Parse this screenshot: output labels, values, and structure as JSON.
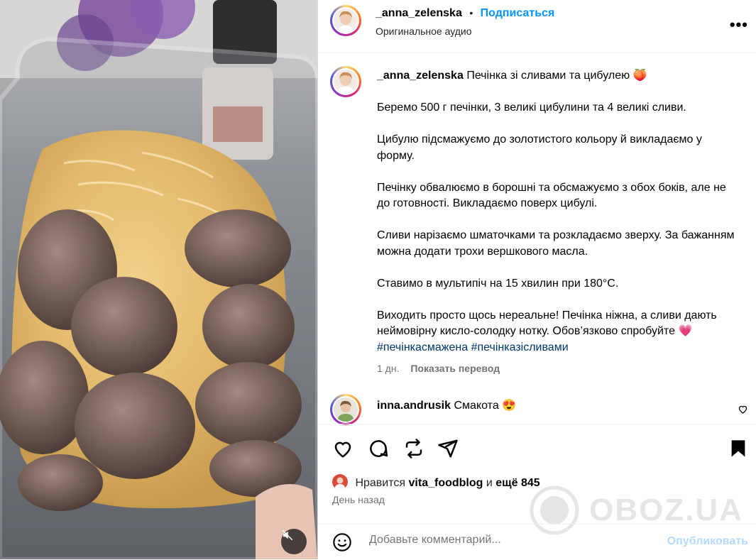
{
  "post": {
    "author": "_anna_zelenska",
    "separator": "•",
    "follow_label": "Подписаться",
    "audio": "Оригинальное аудио",
    "more_label": "•••"
  },
  "caption": {
    "username": "_anna_zelenska",
    "title": "Печінка зі сливами та цибулею",
    "title_emoji": "🍑",
    "paragraphs": [
      "Беремо 500 г печінки, 3 великі цибулини та 4 великі сливи.",
      "Цибулю підсмажуємо до золотистого кольору й викладаємо у форму.",
      "Печінку обвалюємо в борошні та обсмажуємо з обох боків, але не до готовності. Викладаємо поверх цибулі.",
      "Сливи нарізаємо шматочками та розкладаємо зверху. За бажанням можна додати трохи вершкового масла.",
      "Ставимо в мультипіч на 15 хвилин при 180°C."
    ],
    "last_paragraph": "Виходить просто щось нереальне! Печінка ніжна, а сливи дають неймовірну кисло-солодку нотку. Обов’язково спробуйте",
    "last_emoji": "💗",
    "hashtags": [
      "#печінкасмажена",
      "#печінказісливами"
    ],
    "age": "1 дн.",
    "translate_label": "Показать перевод"
  },
  "comment": {
    "username": "inna.andrusik",
    "text": "Смакота",
    "emoji": "😍"
  },
  "likes": {
    "prefix": "Нравится",
    "user": "vita_foodblog",
    "and": "и",
    "count_text": "ещё 845"
  },
  "posted": "День назад",
  "comment_box": {
    "placeholder": "Добавьте комментарий...",
    "publish_label": "Опубликовать"
  },
  "watermark": "OBOZ.UA",
  "colors": {
    "link_blue": "#0095f6",
    "hashtag": "#00376b",
    "secondary_text": "#737373",
    "publish_disabled": "#b3dbff"
  }
}
